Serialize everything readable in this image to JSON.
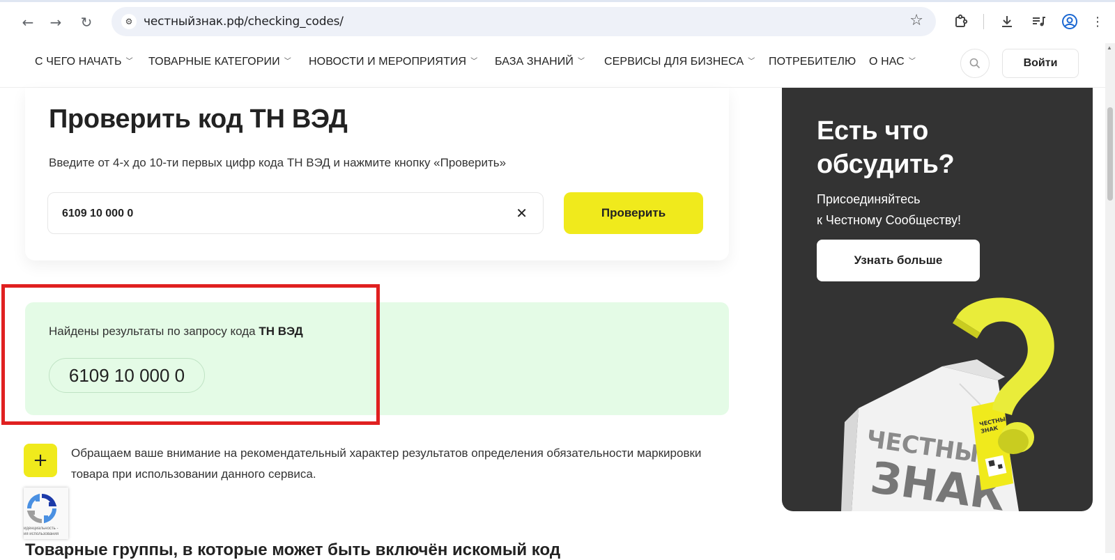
{
  "browser": {
    "url": "честныйзнак.рф/checking_codes/",
    "icons": {
      "back": "arrow-left-icon",
      "forward": "arrow-right-icon",
      "reload": "reload-icon",
      "site_settings": "tune-icon",
      "bookmark": "star-icon",
      "extensions": "puzzle-icon",
      "downloads": "download-icon",
      "media": "playlist-icon",
      "profile": "profile-icon",
      "menu": "more-vert-icon"
    }
  },
  "header": {
    "menu": [
      {
        "label": "С ЧЕГО НАЧАТЬ",
        "has_dropdown": true
      },
      {
        "label": "ТОВАРНЫЕ КАТЕГОРИИ",
        "has_dropdown": true
      },
      {
        "label": "НОВОСТИ И МЕРОПРИЯТИЯ",
        "has_dropdown": true
      },
      {
        "label": "БАЗА ЗНАНИЙ",
        "has_dropdown": true
      },
      {
        "label": "СЕРВИСЫ ДЛЯ БИЗНЕСА",
        "has_dropdown": true
      },
      {
        "label": "ПОТРЕБИТЕЛЮ",
        "has_dropdown": false
      },
      {
        "label": "О НАС",
        "has_dropdown": true
      }
    ],
    "login_label": "Войти"
  },
  "check": {
    "title": "Проверить код ТН ВЭД",
    "description": "Введите от 4-х до 10-ти первых цифр кода ТН ВЭД и нажмите кнопку «Проверить»",
    "input_value": "6109 10 000 0",
    "button_label": "Проверить"
  },
  "result": {
    "text_prefix": "Найдены результаты по запросу кода ",
    "text_bold": "ТН ВЭД",
    "code": "6109 10 000 0"
  },
  "notice": {
    "text": "Обращаем ваше внимание на рекомендательный характер результатов определения обязательности маркировки товара при использовании данного сервиса.",
    "toggle_label": "+"
  },
  "recaptcha": {
    "text_line1": "иденциальность -",
    "text_line2": "ия использования"
  },
  "section_heading": "Товарные группы, в которые может быть включён искомый код",
  "promo": {
    "title": "Есть что обсудить?",
    "text_line1": "Присоединяйтесь",
    "text_line2": "к Честному Сообществу!",
    "button_label": "Узнать больше",
    "art_text_top": "ЧЕСТНЫЙ",
    "art_text_bottom": "ЗНАК",
    "tag_text_top": "ЧЕСТНЫЙ",
    "tag_text_bottom": "ЗНАК"
  },
  "colors": {
    "accent_yellow": "#f0ea1c",
    "result_bg": "#e4fbe6",
    "promo_bg": "#333333",
    "highlight": "#e02020"
  }
}
